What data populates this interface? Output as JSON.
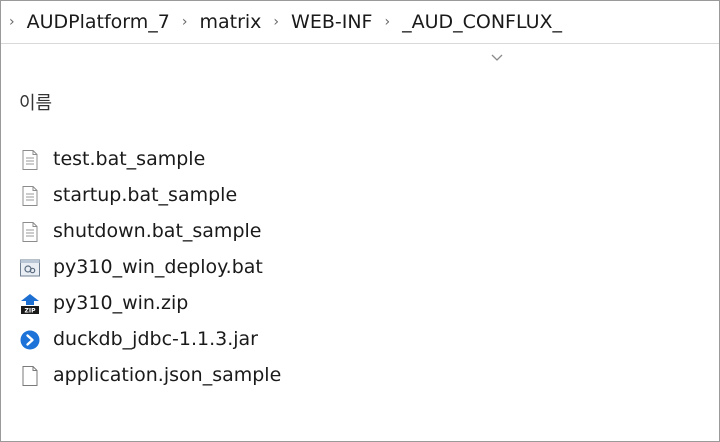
{
  "breadcrumb": {
    "items": [
      "AUDPlatform_7",
      "matrix",
      "WEB-INF",
      "_AUD_CONFLUX_"
    ]
  },
  "columns": {
    "name_label": "이름"
  },
  "files": [
    {
      "name": "test.bat_sample",
      "icon": "text-file-icon"
    },
    {
      "name": "startup.bat_sample",
      "icon": "text-file-icon"
    },
    {
      "name": "shutdown.bat_sample",
      "icon": "text-file-icon"
    },
    {
      "name": "py310_win_deploy.bat",
      "icon": "batch-file-icon"
    },
    {
      "name": "py310_win.zip",
      "icon": "zip-archive-icon"
    },
    {
      "name": "duckdb_jdbc-1.1.3.jar",
      "icon": "jar-file-icon"
    },
    {
      "name": "application.json_sample",
      "icon": "blank-file-icon"
    }
  ]
}
